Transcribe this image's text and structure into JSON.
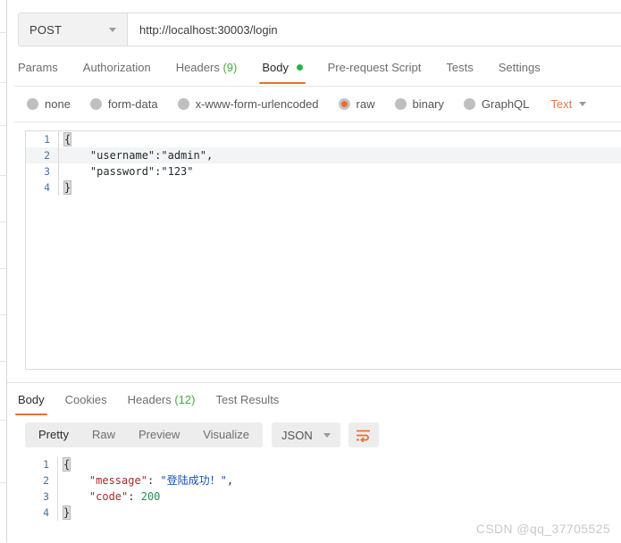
{
  "request": {
    "method": "POST",
    "url": "http://localhost:30003/login",
    "tabs": [
      {
        "label": "Params",
        "count": "",
        "active": false
      },
      {
        "label": "Authorization",
        "count": "",
        "active": false
      },
      {
        "label": "Headers",
        "count": "(9)",
        "active": false
      },
      {
        "label": "Body",
        "count": "",
        "active": true
      },
      {
        "label": "Pre-request Script",
        "count": "",
        "active": false
      },
      {
        "label": "Tests",
        "count": "",
        "active": false
      },
      {
        "label": "Settings",
        "count": "",
        "active": false
      }
    ],
    "body_types": [
      {
        "label": "none",
        "selected": false
      },
      {
        "label": "form-data",
        "selected": false
      },
      {
        "label": "x-www-form-urlencoded",
        "selected": false
      },
      {
        "label": "raw",
        "selected": true
      },
      {
        "label": "binary",
        "selected": false
      },
      {
        "label": "GraphQL",
        "selected": false
      }
    ],
    "raw_format": "Text",
    "body_lines": [
      {
        "n": "1",
        "text": "{"
      },
      {
        "n": "2",
        "text": "    \"username\":\"admin\","
      },
      {
        "n": "3",
        "text": "    \"password\":\"123\""
      },
      {
        "n": "4",
        "text": "}"
      }
    ]
  },
  "response": {
    "tabs": [
      {
        "label": "Body",
        "count": "",
        "active": true
      },
      {
        "label": "Cookies",
        "count": "",
        "active": false
      },
      {
        "label": "Headers",
        "count": "(12)",
        "active": false
      },
      {
        "label": "Test Results",
        "count": "",
        "active": false
      }
    ],
    "view_modes": [
      {
        "label": "Pretty",
        "active": true
      },
      {
        "label": "Raw",
        "active": false
      },
      {
        "label": "Preview",
        "active": false
      },
      {
        "label": "Visualize",
        "active": false
      }
    ],
    "format": "JSON",
    "wrap_icon": "word-wrap-icon",
    "lines": [
      {
        "n": "1",
        "open_brace": "{"
      },
      {
        "n": "2",
        "key": "\"message\"",
        "colon": ": ",
        "value": "\"登陆成功！\"",
        "trail": ","
      },
      {
        "n": "3",
        "key": "\"code\"",
        "colon": ": ",
        "number": "200",
        "trail": ""
      },
      {
        "n": "4",
        "close_brace": "}"
      }
    ]
  },
  "watermark": "CSDN @qq_37705525",
  "colors": {
    "accent": "#ef6c33",
    "green": "#2bb24c",
    "count_green": "#49a942",
    "json_key": "#a52a2a",
    "json_string": "#1a4fb4",
    "json_number": "#2e8b57"
  }
}
